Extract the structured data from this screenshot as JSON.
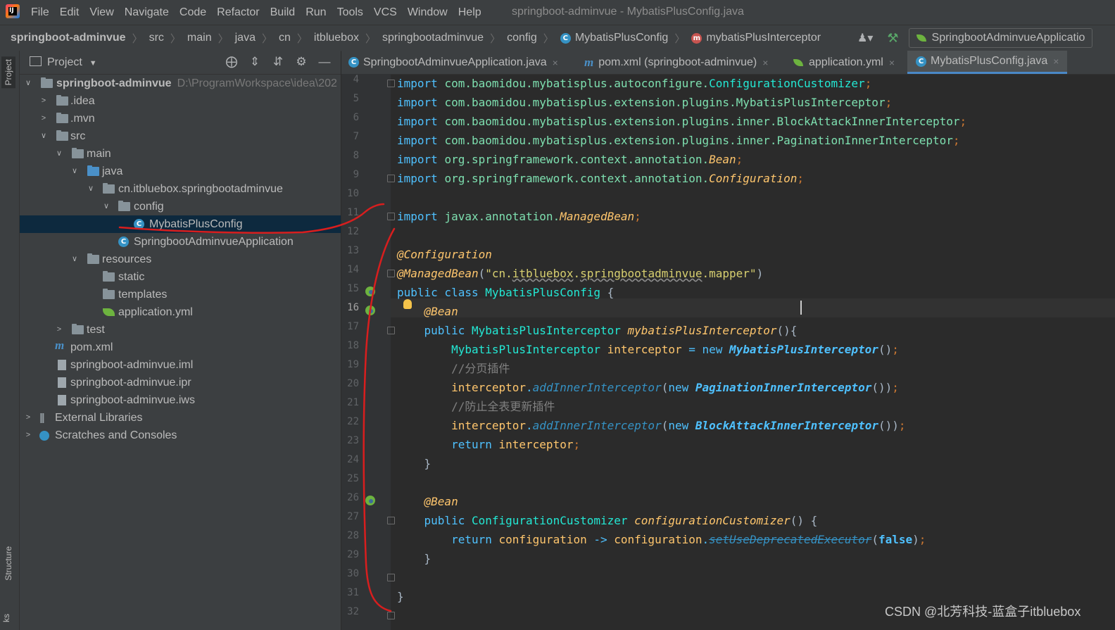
{
  "app": {
    "logo_text": "IJ",
    "menu": [
      "File",
      "Edit",
      "View",
      "Navigate",
      "Code",
      "Refactor",
      "Build",
      "Run",
      "Tools",
      "VCS",
      "Window",
      "Help"
    ],
    "window_title": "springboot-adminvue - MybatisPlusConfig.java"
  },
  "breadcrumbs": {
    "items": [
      "springboot-adminvue",
      "src",
      "main",
      "java",
      "cn",
      "itbluebox",
      "springbootadminvue",
      "config",
      "MybatisPlusConfig",
      "mybatisPlusInterceptor"
    ],
    "separator": "〉",
    "class_icon": "C",
    "method_icon": "m"
  },
  "toolbar": {
    "user_icon": "user-icon",
    "build_icon": "hammer-icon",
    "run_config": "SpringbootAdminvueApplicatio"
  },
  "tool_stripe": {
    "project": "Project",
    "structure": "Structure",
    "extra": "ks"
  },
  "project_panel": {
    "title": "Project",
    "tools": [
      "locate-icon",
      "expand-all-icon",
      "collapse-all-icon",
      "gear-icon",
      "hide-icon"
    ],
    "tree": [
      {
        "label": "springboot-adminvue",
        "path": "D:\\ProgramWorkspace\\idea\\202",
        "bold": true
      },
      {
        "label": ".idea"
      },
      {
        "label": ".mvn"
      },
      {
        "label": "src"
      },
      {
        "label": "main"
      },
      {
        "label": "java"
      },
      {
        "label": "cn.itbluebox.springbootadminvue"
      },
      {
        "label": "config"
      },
      {
        "label": "MybatisPlusConfig"
      },
      {
        "label": "SpringbootAdminvueApplication"
      },
      {
        "label": "resources"
      },
      {
        "label": "static"
      },
      {
        "label": "templates"
      },
      {
        "label": "application.yml"
      },
      {
        "label": "test"
      },
      {
        "label": "pom.xml"
      },
      {
        "label": "springboot-adminvue.iml"
      },
      {
        "label": "springboot-adminvue.ipr"
      },
      {
        "label": "springboot-adminvue.iws"
      },
      {
        "label": "External Libraries"
      },
      {
        "label": "Scratches and Consoles"
      }
    ]
  },
  "editor": {
    "tabs": [
      {
        "label": "SpringbootAdminvueApplication.java",
        "active": false
      },
      {
        "label": "pom.xml (springboot-adminvue)",
        "active": false
      },
      {
        "label": "application.yml",
        "active": false
      },
      {
        "label": "MybatisPlusConfig.java",
        "active": true
      }
    ],
    "close_glyph": "×",
    "current_line": 16,
    "line_numbers": [
      "4",
      "5",
      "6",
      "7",
      "8",
      "9",
      "10",
      "11",
      "12",
      "13",
      "14",
      "15",
      "16",
      "17",
      "18",
      "19",
      "20",
      "21",
      "22",
      "23",
      "24",
      "25",
      "26",
      "27",
      "28",
      "29",
      "30",
      "31",
      "32"
    ],
    "code": {
      "l4a": "import ",
      "l4b": "com.baomidou.mybatisplus.autoconfigure.",
      "l4c": "ConfigurationCustomizer",
      "l4d": ";",
      "l5a": "import ",
      "l5b": "com.baomidou.mybatisplus.extension.plugins.MybatisPlusInterceptor",
      "l5d": ";",
      "l6a": "import ",
      "l6b": "com.baomidou.mybatisplus.extension.plugins.inner.BlockAttackInnerInterceptor",
      "l6d": ";",
      "l7a": "import ",
      "l7b": "com.baomidou.mybatisplus.extension.plugins.inner.PaginationInnerInterceptor",
      "l7d": ";",
      "l8a": "import ",
      "l8b": "org.springframework.context.annotation.",
      "l8c": "Bean",
      "l8d": ";",
      "l9a": "import ",
      "l9b": "org.springframework.context.annotation.",
      "l9c": "Configuration",
      "l9d": ";",
      "l11a": "import ",
      "l11b": "javax.annotation.",
      "l11c": "ManagedBean",
      "l11d": ";",
      "l13a": "@Configuration",
      "l14a": "@ManagedBean",
      "l14b": "(",
      "l14c": "\"cn.",
      "l14d": "itbluebox",
      "l14e": ".",
      "l14f": "springbootadminvue",
      "l14g": ".mapper\"",
      "l14h": ")",
      "l15a": "public class ",
      "l15b": "MybatisPlusConfig",
      "l15c": " {",
      "l16a": "    ",
      "l16b": "@Bean",
      "l17a": "    public ",
      "l17b": "MybatisPlusInterceptor ",
      "l17c": "mybatisPlusInterceptor",
      "l17d": "(){",
      "l18a": "        ",
      "l18b": "MybatisPlusInterceptor ",
      "l18c": "interceptor ",
      "l18d": "= ",
      "l18e": "new ",
      "l18f": "MybatisPlusInterceptor",
      "l18g": "()",
      "l18h": ";",
      "l19a": "        //分页插件",
      "l20a": "        ",
      "l20b": "interceptor",
      "l20c": ".",
      "l20d": "addInnerInterceptor",
      "l20e": "(",
      "l20f": "new ",
      "l20g": "PaginationInnerInterceptor",
      "l20h": "())",
      "l20i": ";",
      "l21a": "        //防止全表更新插件",
      "l22a": "        ",
      "l22b": "interceptor",
      "l22c": ".",
      "l22d": "addInnerInterceptor",
      "l22e": "(",
      "l22f": "new ",
      "l22g": "BlockAttackInnerInterceptor",
      "l22h": "())",
      "l22i": ";",
      "l23a": "        return ",
      "l23b": "interceptor",
      "l23c": ";",
      "l24a": "    }",
      "l26a": "    ",
      "l26b": "@Bean",
      "l27a": "    public ",
      "l27b": "ConfigurationCustomizer ",
      "l27c": "configurationCustomizer",
      "l27d": "() {",
      "l28a": "        return ",
      "l28b": "configuration ",
      "l28c": "-> ",
      "l28d": "configuration",
      "l28e": ".",
      "l28f": "setUseDeprecatedExecutor",
      "l28g": "(",
      "l28h": "false",
      "l28i": ")",
      "l28j": ";",
      "l29a": "    }",
      "l31a": "}"
    }
  },
  "watermark": "CSDN @北芳科技-蓝盒子itbluebox",
  "colors": {
    "annotation_stroke": "#d81e1e",
    "selection": "#0d293e",
    "editor_bg": "#2b2b2b"
  }
}
